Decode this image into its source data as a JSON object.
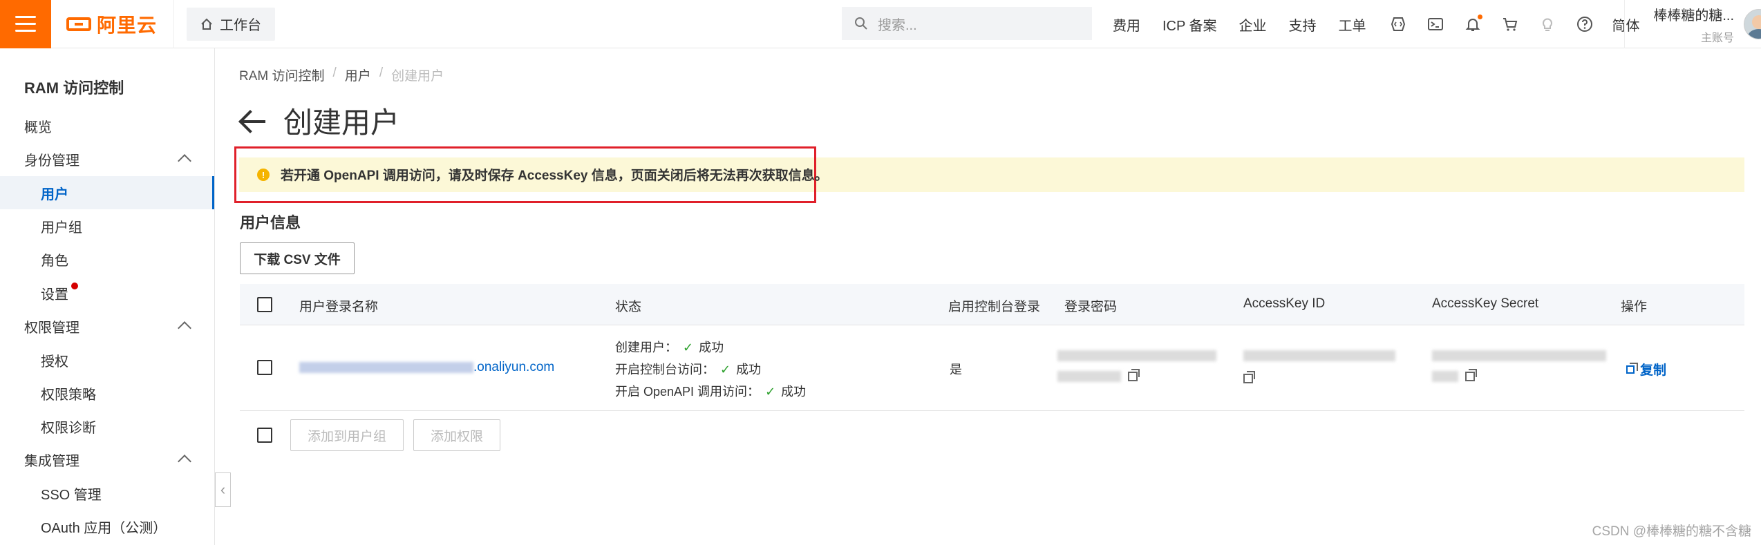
{
  "topbar": {
    "logo_text": "阿里云",
    "workbench_label": "工作台",
    "search_placeholder": "搜索...",
    "nav_items": [
      "费用",
      "ICP 备案",
      "企业",
      "支持",
      "工单"
    ],
    "lang_label": "简体",
    "user_name": "棒棒糖的糖...",
    "user_sub": "主账号",
    "brand_color": "#ff6a00"
  },
  "sidebar": {
    "title": "RAM 访问控制",
    "items": [
      {
        "label": "概览"
      },
      {
        "label": "身份管理"
      },
      {
        "label": "用户"
      },
      {
        "label": "用户组"
      },
      {
        "label": "角色"
      },
      {
        "label": "设置"
      },
      {
        "label": "权限管理"
      },
      {
        "label": "授权"
      },
      {
        "label": "权限策略"
      },
      {
        "label": "权限诊断"
      },
      {
        "label": "集成管理"
      },
      {
        "label": "SSO 管理"
      },
      {
        "label": "OAuth 应用（公测）"
      }
    ]
  },
  "breadcrumb": {
    "items": [
      "RAM 访问控制",
      "用户",
      "创建用户"
    ],
    "separator": "/"
  },
  "page": {
    "title": "创建用户",
    "alert": "若开通 OpenAPI 调用访问，请及时保存 AccessKey 信息，页面关闭后将无法再次获取信息。",
    "section_title": "用户信息",
    "download_button": "下载 CSV 文件"
  },
  "table": {
    "headers": [
      "用户登录名称",
      "状态",
      "启用控制台登录",
      "登录密码",
      "AccessKey ID",
      "AccessKey Secret",
      "操作"
    ],
    "row": {
      "login_suffix": ".onaliyun.com",
      "status": [
        {
          "label": "创建用户：",
          "result": "成功"
        },
        {
          "label": "开启控制台访问：",
          "result": "成功"
        },
        {
          "label": "开启 OpenAPI 调用访问：",
          "result": "成功"
        }
      ],
      "console_login": "是",
      "action": "复制"
    },
    "footer_buttons": [
      "添加到用户组",
      "添加权限"
    ]
  },
  "watermark": "CSDN @棒棒糖的糖不含糖"
}
